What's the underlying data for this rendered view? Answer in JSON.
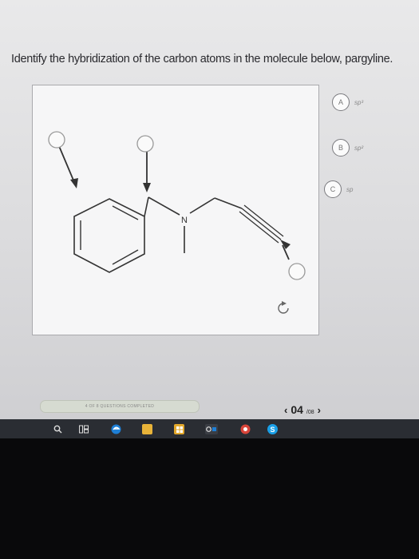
{
  "question": {
    "text": "Identify the hybridization of the carbon atoms in the molecule below, pargyline."
  },
  "molecule": {
    "nitrogen_label": "N",
    "reset_icon": "reset-icon"
  },
  "choices": [
    {
      "letter": "A",
      "label": "sp³"
    },
    {
      "letter": "B",
      "label": "sp²"
    },
    {
      "letter": "C",
      "label": "sp"
    }
  ],
  "progress": {
    "text": "4 OF 8 QUESTIONS COMPLETED",
    "completed": 4,
    "total": 8
  },
  "pager": {
    "prev": "‹",
    "current": "04",
    "total": "/08",
    "next": "›"
  },
  "taskbar": {
    "icons": [
      "search-icon",
      "task-view-icon",
      "edge-icon",
      "file-explorer-icon",
      "store-icon",
      "office-icon",
      "chrome-icon",
      "skype-icon"
    ],
    "colors": {
      "edge": "#1e7fd6",
      "explorer": "#e8b339",
      "store": "#e2a82c",
      "office": "#d24726",
      "chrome": "#d8453a",
      "skype": "#1aa0e8"
    }
  }
}
